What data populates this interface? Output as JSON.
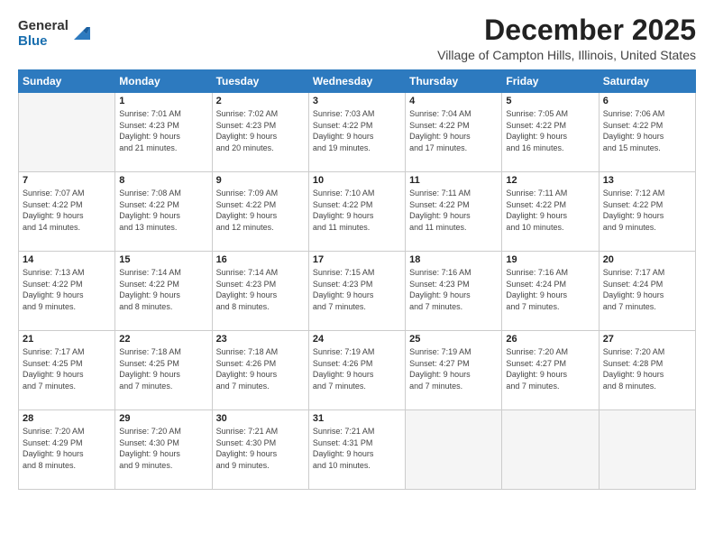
{
  "logo": {
    "general": "General",
    "blue": "Blue"
  },
  "header": {
    "month": "December 2025",
    "location": "Village of Campton Hills, Illinois, United States"
  },
  "days_of_week": [
    "Sunday",
    "Monday",
    "Tuesday",
    "Wednesday",
    "Thursday",
    "Friday",
    "Saturday"
  ],
  "weeks": [
    [
      {
        "day": "",
        "info": ""
      },
      {
        "day": "1",
        "info": "Sunrise: 7:01 AM\nSunset: 4:23 PM\nDaylight: 9 hours\nand 21 minutes."
      },
      {
        "day": "2",
        "info": "Sunrise: 7:02 AM\nSunset: 4:23 PM\nDaylight: 9 hours\nand 20 minutes."
      },
      {
        "day": "3",
        "info": "Sunrise: 7:03 AM\nSunset: 4:22 PM\nDaylight: 9 hours\nand 19 minutes."
      },
      {
        "day": "4",
        "info": "Sunrise: 7:04 AM\nSunset: 4:22 PM\nDaylight: 9 hours\nand 17 minutes."
      },
      {
        "day": "5",
        "info": "Sunrise: 7:05 AM\nSunset: 4:22 PM\nDaylight: 9 hours\nand 16 minutes."
      },
      {
        "day": "6",
        "info": "Sunrise: 7:06 AM\nSunset: 4:22 PM\nDaylight: 9 hours\nand 15 minutes."
      }
    ],
    [
      {
        "day": "7",
        "info": "Sunrise: 7:07 AM\nSunset: 4:22 PM\nDaylight: 9 hours\nand 14 minutes."
      },
      {
        "day": "8",
        "info": "Sunrise: 7:08 AM\nSunset: 4:22 PM\nDaylight: 9 hours\nand 13 minutes."
      },
      {
        "day": "9",
        "info": "Sunrise: 7:09 AM\nSunset: 4:22 PM\nDaylight: 9 hours\nand 12 minutes."
      },
      {
        "day": "10",
        "info": "Sunrise: 7:10 AM\nSunset: 4:22 PM\nDaylight: 9 hours\nand 11 minutes."
      },
      {
        "day": "11",
        "info": "Sunrise: 7:11 AM\nSunset: 4:22 PM\nDaylight: 9 hours\nand 11 minutes."
      },
      {
        "day": "12",
        "info": "Sunrise: 7:11 AM\nSunset: 4:22 PM\nDaylight: 9 hours\nand 10 minutes."
      },
      {
        "day": "13",
        "info": "Sunrise: 7:12 AM\nSunset: 4:22 PM\nDaylight: 9 hours\nand 9 minutes."
      }
    ],
    [
      {
        "day": "14",
        "info": "Sunrise: 7:13 AM\nSunset: 4:22 PM\nDaylight: 9 hours\nand 9 minutes."
      },
      {
        "day": "15",
        "info": "Sunrise: 7:14 AM\nSunset: 4:22 PM\nDaylight: 9 hours\nand 8 minutes."
      },
      {
        "day": "16",
        "info": "Sunrise: 7:14 AM\nSunset: 4:23 PM\nDaylight: 9 hours\nand 8 minutes."
      },
      {
        "day": "17",
        "info": "Sunrise: 7:15 AM\nSunset: 4:23 PM\nDaylight: 9 hours\nand 7 minutes."
      },
      {
        "day": "18",
        "info": "Sunrise: 7:16 AM\nSunset: 4:23 PM\nDaylight: 9 hours\nand 7 minutes."
      },
      {
        "day": "19",
        "info": "Sunrise: 7:16 AM\nSunset: 4:24 PM\nDaylight: 9 hours\nand 7 minutes."
      },
      {
        "day": "20",
        "info": "Sunrise: 7:17 AM\nSunset: 4:24 PM\nDaylight: 9 hours\nand 7 minutes."
      }
    ],
    [
      {
        "day": "21",
        "info": "Sunrise: 7:17 AM\nSunset: 4:25 PM\nDaylight: 9 hours\nand 7 minutes."
      },
      {
        "day": "22",
        "info": "Sunrise: 7:18 AM\nSunset: 4:25 PM\nDaylight: 9 hours\nand 7 minutes."
      },
      {
        "day": "23",
        "info": "Sunrise: 7:18 AM\nSunset: 4:26 PM\nDaylight: 9 hours\nand 7 minutes."
      },
      {
        "day": "24",
        "info": "Sunrise: 7:19 AM\nSunset: 4:26 PM\nDaylight: 9 hours\nand 7 minutes."
      },
      {
        "day": "25",
        "info": "Sunrise: 7:19 AM\nSunset: 4:27 PM\nDaylight: 9 hours\nand 7 minutes."
      },
      {
        "day": "26",
        "info": "Sunrise: 7:20 AM\nSunset: 4:27 PM\nDaylight: 9 hours\nand 7 minutes."
      },
      {
        "day": "27",
        "info": "Sunrise: 7:20 AM\nSunset: 4:28 PM\nDaylight: 9 hours\nand 8 minutes."
      }
    ],
    [
      {
        "day": "28",
        "info": "Sunrise: 7:20 AM\nSunset: 4:29 PM\nDaylight: 9 hours\nand 8 minutes."
      },
      {
        "day": "29",
        "info": "Sunrise: 7:20 AM\nSunset: 4:30 PM\nDaylight: 9 hours\nand 9 minutes."
      },
      {
        "day": "30",
        "info": "Sunrise: 7:21 AM\nSunset: 4:30 PM\nDaylight: 9 hours\nand 9 minutes."
      },
      {
        "day": "31",
        "info": "Sunrise: 7:21 AM\nSunset: 4:31 PM\nDaylight: 9 hours\nand 10 minutes."
      },
      {
        "day": "",
        "info": ""
      },
      {
        "day": "",
        "info": ""
      },
      {
        "day": "",
        "info": ""
      }
    ]
  ]
}
